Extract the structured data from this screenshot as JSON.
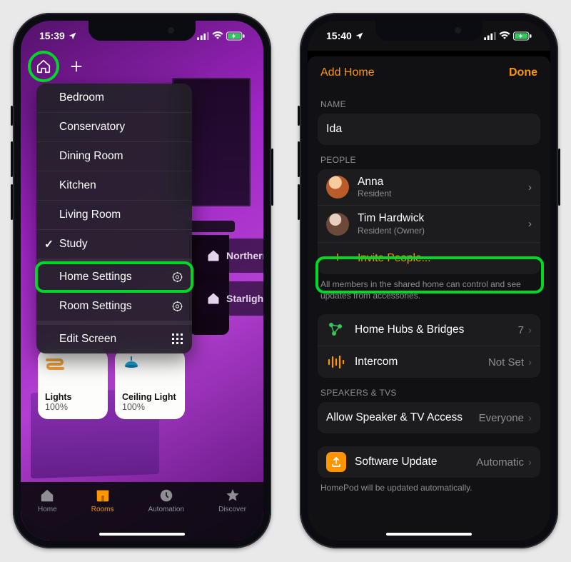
{
  "left": {
    "status": {
      "time": "15:39"
    },
    "dropdown": {
      "rooms": [
        "Bedroom",
        "Conservatory",
        "Dining Room",
        "Kitchen",
        "Living Room",
        "Study"
      ],
      "selectedIndex": 5,
      "homeSettings": "Home Settings",
      "roomSettings": "Room Settings",
      "editScreen": "Edit Screen"
    },
    "scenes": {
      "s1": "Northern",
      "s2": "Starlight"
    },
    "accessories": [
      {
        "name": "Lights",
        "detail": "100%"
      },
      {
        "name": "Ceiling Light",
        "detail": "100%"
      }
    ],
    "tabs": {
      "home": "Home",
      "rooms": "Rooms",
      "automation": "Automation",
      "discover": "Discover"
    }
  },
  "right": {
    "status": {
      "time": "15:40"
    },
    "header": {
      "addHome": "Add Home",
      "done": "Done"
    },
    "nameSection": {
      "caption": "NAME",
      "value": "Ida"
    },
    "peopleSection": {
      "caption": "PEOPLE",
      "members": [
        {
          "name": "Anna",
          "role": "Resident"
        },
        {
          "name": "Tim Hardwick",
          "role": "Resident (Owner)"
        }
      ],
      "invite": "Invite People...",
      "footer": "All members in the shared home can control and see updates from accessories."
    },
    "hubSection": {
      "hubs": "Home Hubs & Bridges",
      "hubsCount": "7",
      "intercom": "Intercom",
      "intercomDetail": "Not Set"
    },
    "speakersSection": {
      "caption": "SPEAKERS & TVS",
      "allow": "Allow Speaker & TV Access",
      "allowDetail": "Everyone"
    },
    "updateSection": {
      "title": "Software Update",
      "detail": "Automatic",
      "footer": "HomePod will be updated automatically."
    }
  }
}
